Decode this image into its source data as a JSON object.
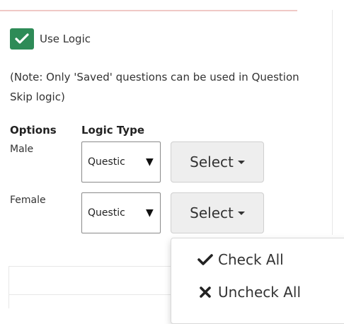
{
  "logic": {
    "use_logic_label": "Use Logic",
    "use_logic_checked": true,
    "note": "(Note: Only 'Saved' questions can be used in Question Skip logic)"
  },
  "table": {
    "headers": {
      "options": "Options",
      "logic_type": "Logic Type"
    },
    "rows": [
      {
        "option": "Male",
        "logic_type": "Questic",
        "select_label": "Select"
      },
      {
        "option": "Female",
        "logic_type": "Questic",
        "select_label": "Select"
      }
    ]
  },
  "menu": {
    "check_all": "Check All",
    "uncheck_all": "Uncheck All"
  },
  "colors": {
    "checkbox": "#2e8b57",
    "button_bg": "#eeeeee"
  }
}
